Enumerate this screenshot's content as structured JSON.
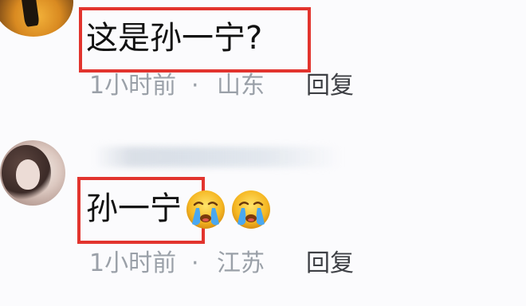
{
  "comments": [
    {
      "text": "这是孙一宁?",
      "time": "1小时前",
      "separator": "·",
      "location": "山东",
      "reply_label": "回复",
      "emojis": []
    },
    {
      "text": "孙一宁",
      "time": "1小时前",
      "separator": "·",
      "location": "江苏",
      "reply_label": "回复",
      "emojis": [
        "crying-face-icon",
        "crying-face-icon"
      ]
    }
  ],
  "colors": {
    "highlight_box": "#e2342e",
    "meta_text": "#9aa0a8",
    "reply_text": "#3d3f44",
    "body_text": "#111111",
    "background": "#fbfbfd"
  }
}
